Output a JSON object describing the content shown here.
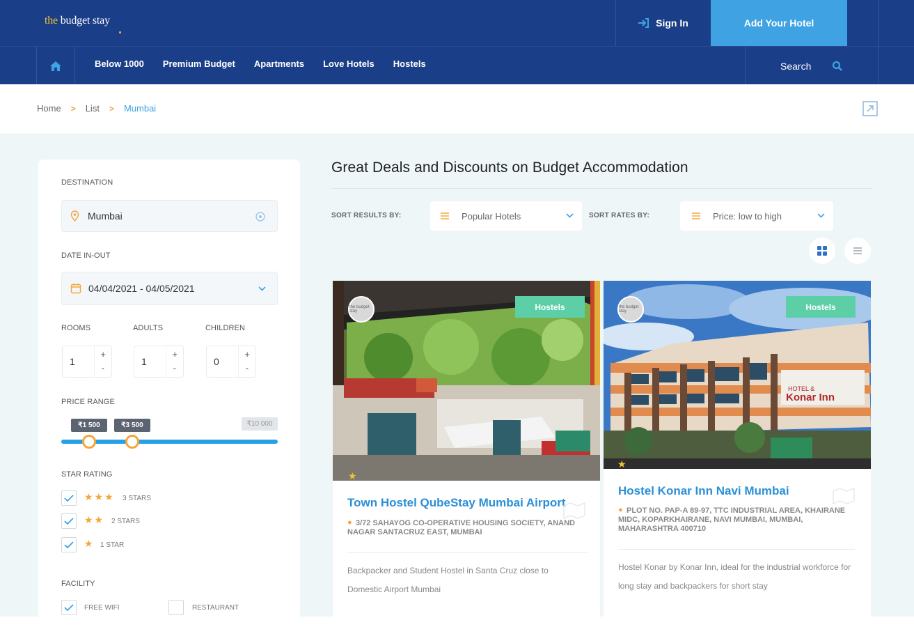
{
  "header": {
    "logo_the": "the",
    "logo_rest": " budget stay",
    "sign_in": "Sign In",
    "add_hotel": "Add Your Hotel"
  },
  "nav": {
    "links": [
      "Below 1000",
      "Premium Budget",
      "Apartments",
      "Love Hotels",
      "Hostels"
    ],
    "search": "Search"
  },
  "breadcrumb": {
    "home": "Home",
    "list": "List",
    "current": "Mumbai",
    "sep": ">"
  },
  "sidebar": {
    "destination_label": "DESTINATION",
    "destination_value": "Mumbai",
    "date_label": "DATE IN-OUT",
    "date_value": "04/04/2021 - 04/05/2021",
    "rooms_label": "ROOMS",
    "adults_label": "ADULTS",
    "children_label": "CHILDREN",
    "rooms": "1",
    "adults": "1",
    "children": "0",
    "price_label": "PRICE RANGE",
    "price_min": "₹1 500",
    "price_max_sel": "₹3 500",
    "price_cap": "₹10 000",
    "star_label": "STAR RATING",
    "star_3": "3 STARS",
    "star_2": "2 STARS",
    "star_1": "1 STAR",
    "facility_label": "FACILITY",
    "free_wifi": "FREE WIFI",
    "restaurant": "RESTAURANT"
  },
  "content": {
    "heading": "Great Deals and Discounts on Budget Accommodation",
    "sort_results_label": "SORT RESULTS BY:",
    "sort_results_value": "Popular Hotels",
    "sort_rates_label": "SORT RATES BY:",
    "sort_rates_value": "Price: low to high"
  },
  "cards": [
    {
      "badge": "Hostels",
      "title": "Town Hostel QubeStay Mumbai Airport",
      "address": "3/72 SAHAYOG CO-OPERATIVE HOUSING SOCIETY, ANAND NAGAR SANTACRUZ EAST, MUMBAI",
      "desc": "Backpacker and Student Hostel in Santa Cruz close to Domestic Airport Mumbai",
      "avatar": "the budget stay"
    },
    {
      "badge": "Hostels",
      "title": "Hostel Konar Inn Navi Mumbai",
      "address": "PLOT NO. PAP-A 89-97, TTC INDUSTRIAL AREA, KHAIRANE MIDC, KOPARKHAIRANE, NAVI MUMBAI, MUMBAI, MAHARASHTRA 400710",
      "desc": "Hostel Konar by Konar Inn, ideal for the industrial workforce for long stay and backpackers for short stay",
      "avatar": "the budget stay",
      "sign_line1": "HOTEL &",
      "sign_line2": "Konar Inn"
    }
  ],
  "colors": {
    "header_bg": "#1a3e87",
    "accent": "#3fa3e3",
    "orange": "#f3a73a",
    "badge": "#5ccfa7",
    "page_bg": "#eef6f8"
  }
}
